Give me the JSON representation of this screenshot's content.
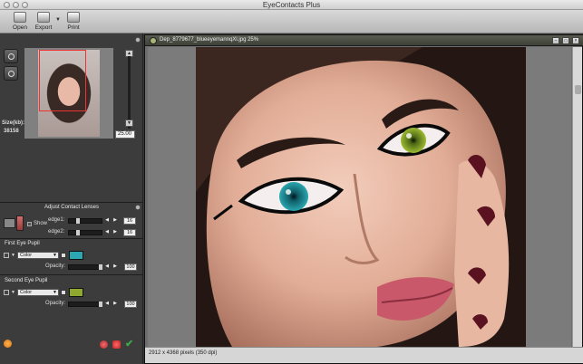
{
  "window": {
    "title": "EyeContacts Plus"
  },
  "toolbar": {
    "open_label": "Open",
    "export_label": "Export",
    "print_label": "Print"
  },
  "navigator": {
    "size_label": "Size(kb):",
    "size_value": "38158",
    "zoom_value": "25.00"
  },
  "adjust": {
    "title": "Adjust Contact Lenses",
    "show_label": "Show",
    "edge1_label": "edge1:",
    "edge1_value": "16",
    "edge2_label": "edge2:",
    "edge2_value": "16"
  },
  "first_eye": {
    "title": "First Eye Pupil",
    "mode": "Color",
    "color": "#2aa7b0",
    "opacity_label": "Opacity:",
    "opacity_value": "100"
  },
  "second_eye": {
    "title": "Second Eye Pupil",
    "mode": "Color",
    "color": "#8fa92f",
    "opacity_label": "Opacity:",
    "opacity_value": "100"
  },
  "document": {
    "name": "Dep_8779677_blueeyemannqXl.jpg 25%",
    "status": "2912 x 4368 pixels (350 dpi)"
  },
  "colors": {
    "first_pupil": "#2aa7b0",
    "second_pupil": "#8fa92f",
    "accent_green": "#3aa84a",
    "accent_red": "#d23a3a"
  }
}
